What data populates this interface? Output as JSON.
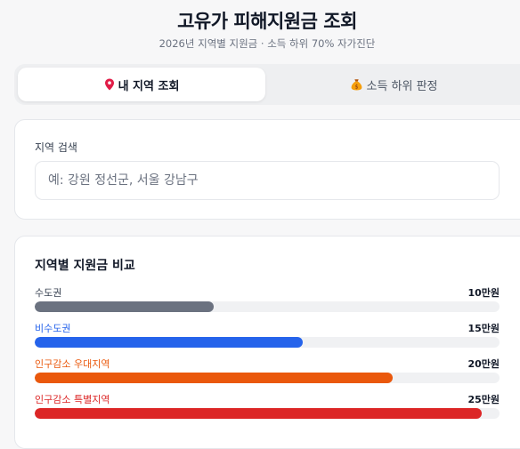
{
  "header": {
    "title": "고유가 피해지원금 조회",
    "subtitle": "2026년 지역별 지원금 · 소득 하위 70% 자가진단"
  },
  "tabs": [
    {
      "label": "내 지역 조회",
      "icon": "map-pin-icon",
      "active": true
    },
    {
      "label": "소득 하위 판정",
      "icon": "money-bag-icon",
      "active": false
    }
  ],
  "search": {
    "label": "지역 검색",
    "placeholder": "예: 강원 정선군, 서울 강남구",
    "value": ""
  },
  "comparison": {
    "title": "지역별 지원금 비교",
    "max_value": 26,
    "rows": [
      {
        "name": "수도권",
        "value_label": "10만원",
        "value": 10,
        "color": "#6b7280",
        "name_color": "#374151"
      },
      {
        "name": "비수도권",
        "value_label": "15만원",
        "value": 15,
        "color": "#2563eb",
        "name_color": "#2563eb"
      },
      {
        "name": "인구감소 우대지역",
        "value_label": "20만원",
        "value": 20,
        "color": "#ea580c",
        "name_color": "#ea580c"
      },
      {
        "name": "인구감소 특별지역",
        "value_label": "25만원",
        "value": 25,
        "color": "#dc2626",
        "name_color": "#dc2626"
      }
    ]
  }
}
